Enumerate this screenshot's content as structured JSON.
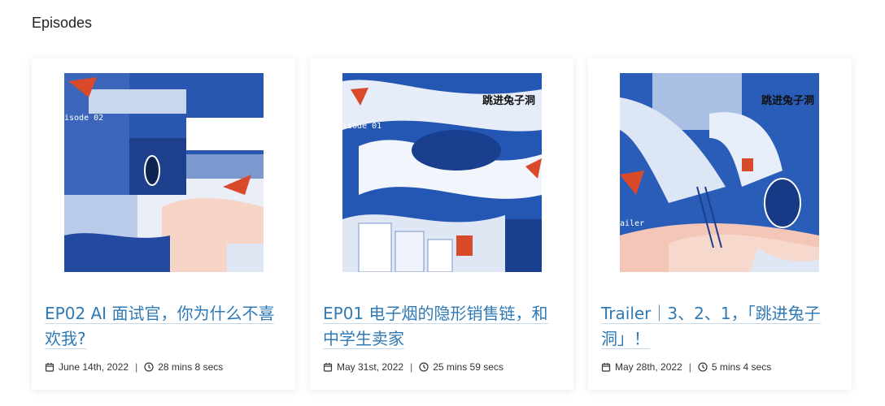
{
  "section": {
    "title": "Episodes"
  },
  "episodes": [
    {
      "title": "EP02 AI 面试官，你为什么不喜欢我?",
      "date": "June 14th, 2022",
      "duration": "28 mins 8 secs",
      "cover_text": "isode 02",
      "cover_icon": "episode-02-artwork"
    },
    {
      "title": "EP01 电子烟的隐形销售链，和中学生卖家",
      "date": "May 31st, 2022",
      "duration": "25 mins 59 secs",
      "cover_text": "isode 01",
      "cover_logo": "跳进兔子洞",
      "cover_icon": "episode-01-artwork"
    },
    {
      "title": "Trailer｜3、2、1，「跳进兔子洞」！",
      "date": "May 28th, 2022",
      "duration": "5 mins 4 secs",
      "cover_text": "ailer",
      "cover_logo": "跳进兔子洞",
      "cover_icon": "trailer-artwork"
    }
  ],
  "icons": {
    "date": "calendar-icon",
    "duration": "clock-icon"
  },
  "colors": {
    "title": "#2f7ab5",
    "cover_blue": "#1f4ea6",
    "cover_pink": "#f3c6b8"
  }
}
